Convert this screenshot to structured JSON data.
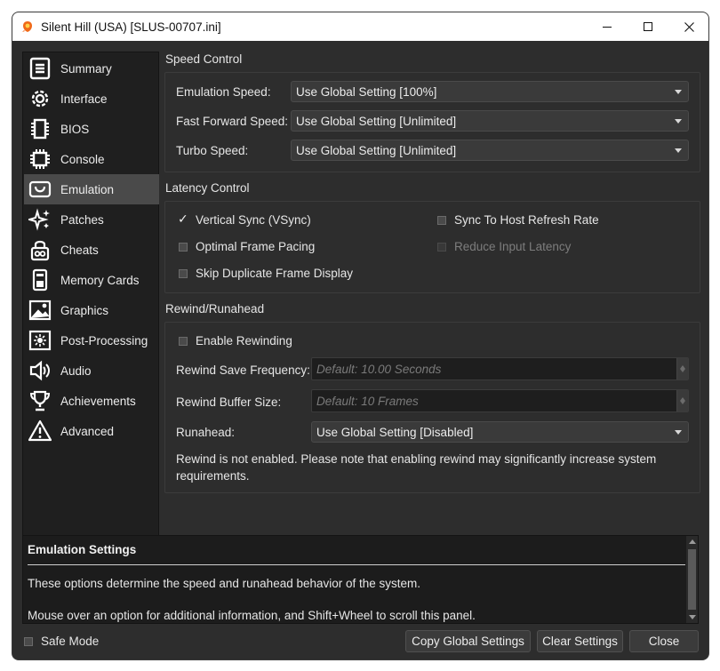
{
  "window": {
    "title": "Silent Hill (USA) [SLUS-00707.ini]",
    "app_icon": "duck-icon",
    "controls": {
      "minimize": "minimize-icon",
      "maximize": "maximize-icon",
      "close": "close-icon"
    }
  },
  "sidebar": {
    "items": [
      {
        "label": "Summary",
        "icon": "document-list-icon",
        "active": false
      },
      {
        "label": "Interface",
        "icon": "gear-icon",
        "active": false
      },
      {
        "label": "BIOS",
        "icon": "chip-icon",
        "active": false
      },
      {
        "label": "Console",
        "icon": "cpu-icon",
        "active": false
      },
      {
        "label": "Emulation",
        "icon": "gamepad-icon",
        "active": true
      },
      {
        "label": "Patches",
        "icon": "sparkles-icon",
        "active": false
      },
      {
        "label": "Cheats",
        "icon": "cheat-lock-icon",
        "active": false
      },
      {
        "label": "Memory Cards",
        "icon": "memory-card-icon",
        "active": false
      },
      {
        "label": "Graphics",
        "icon": "image-icon",
        "active": false
      },
      {
        "label": "Post-Processing",
        "icon": "sun-frame-icon",
        "active": false
      },
      {
        "label": "Audio",
        "icon": "speaker-icon",
        "active": false
      },
      {
        "label": "Achievements",
        "icon": "trophy-icon",
        "active": false
      },
      {
        "label": "Advanced",
        "icon": "warning-icon",
        "active": false
      }
    ]
  },
  "speed_control": {
    "title": "Speed Control",
    "emulation_speed": {
      "label": "Emulation Speed:",
      "value": "Use Global Setting [100%]"
    },
    "fast_forward_speed": {
      "label": "Fast Forward Speed:",
      "value": "Use Global Setting [Unlimited]"
    },
    "turbo_speed": {
      "label": "Turbo Speed:",
      "value": "Use Global Setting [Unlimited]"
    }
  },
  "latency_control": {
    "title": "Latency Control",
    "vsync": {
      "label": "Vertical Sync (VSync)",
      "checked": true
    },
    "sync_host": {
      "label": "Sync To Host Refresh Rate",
      "checked": false
    },
    "optimal_pacing": {
      "label": "Optimal Frame Pacing",
      "checked": false
    },
    "reduce_latency": {
      "label": "Reduce Input Latency",
      "checked": false,
      "disabled": true
    },
    "skip_duplicate": {
      "label": "Skip Duplicate Frame Display",
      "checked": false
    }
  },
  "rewind": {
    "title": "Rewind/Runahead",
    "enable": {
      "label": "Enable Rewinding",
      "checked": false
    },
    "save_frequency": {
      "label": "Rewind Save Frequency:",
      "placeholder": "Default: 10.00 Seconds"
    },
    "buffer_size": {
      "label": "Rewind Buffer Size:",
      "placeholder": "Default: 10 Frames"
    },
    "runahead": {
      "label": "Runahead:",
      "value": "Use Global Setting [Disabled]"
    },
    "note_line1": "Rewind is not enabled. Please note that enabling rewind may significantly increase system",
    "note_line2": "requirements."
  },
  "info": {
    "title": "Emulation Settings",
    "line1": "These options determine the speed and runahead behavior of the system.",
    "line2": "Mouse over an option for additional information, and Shift+Wheel to scroll this panel."
  },
  "footer": {
    "safe_mode": {
      "label": "Safe Mode",
      "checked": false
    },
    "copy_global": "Copy Global Settings",
    "clear": "Clear Settings",
    "close": "Close"
  }
}
